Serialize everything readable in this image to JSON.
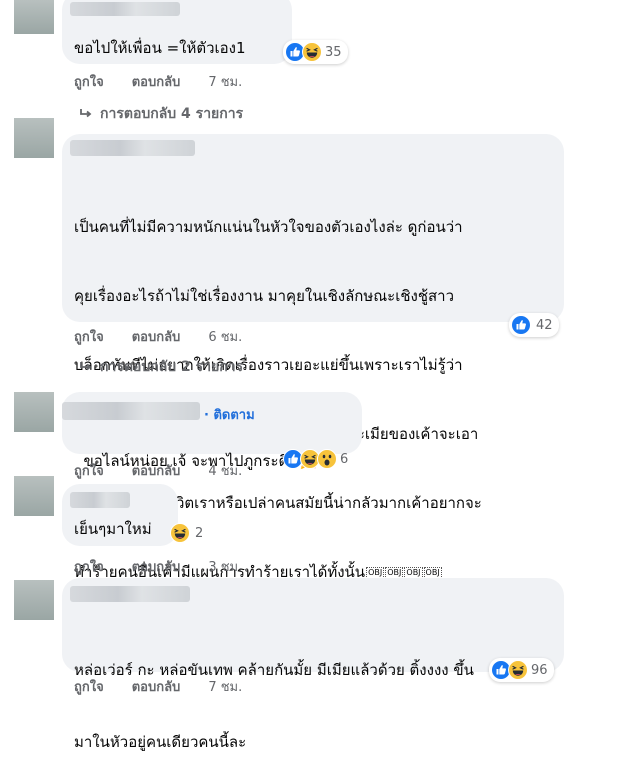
{
  "comments": [
    {
      "text": "ขอไปให้เพื่อน =ให้ตัวเอง1",
      "reaction_count": "35",
      "like": "ถูกใจ",
      "reply": "ตอบกลับ",
      "time": "7 ชม.",
      "replies_label": "การตอบกลับ 4 รายการ"
    },
    {
      "lines": [
        "เป็นคนที่ไม่มีความหนักแน่นในหัวใจของตัวเองไงล่ะ ดูก่อนว่า",
        "คุยเรื่องอะไรถ้าไม่ใช่เรื่องงาน มาคุยในเชิงลักษณะเชิงชู้สาว",
        "บล็อกทันทีไม่อยากให้เกิดเรื่องราวเยอะแย่ขึ้นเพราะเราไม่รู้ว่า",
        "ผู้ชายที่มีเมียแล้วเนี่ยเค้าคิดจะทำอะไรเราและเมียของเค้าจะเอา",
        "จุดนี้มาทำลายชีวิตเราหรือเปล่าคนสมัยนี้น่ากลัวมากเค้าอยากจะ",
        "ทำร้ายคนอื่นเค้ามีแผนการทำร้ายเราได้ทั้งนั้น"
      ],
      "obj_marks": [
        "OBJ",
        "OBJ",
        "OBJ",
        "OBJ"
      ],
      "reaction_count": "42",
      "like": "ถูกใจ",
      "reply": "ตอบกลับ",
      "time": "6 ชม.",
      "replies_label": "การตอบกลับ 2 รายการ"
    },
    {
      "follow": "· ติดตาม",
      "text": "ขอไลน์หน่อย เจ้ จะพาไปภูกระดึง",
      "confetti": "🎉",
      "reaction_count": "6",
      "like": "ถูกใจ",
      "reply": "ตอบกลับ",
      "time": "4 ชม."
    },
    {
      "text": "เย็นๆมาใหม่",
      "reaction_count": "2",
      "like": "ถูกใจ",
      "reply": "ตอบกลับ",
      "time": "3 ชม."
    },
    {
      "lines": [
        "หล่อเว่อร์ กะ หล่อขันเทพ คล้ายกันมั้ย มีเมียแล้วด้วย ติ้งงงง ขึ้น",
        "มาในหัวอยู่คนเดียวคนนี้ละ"
      ],
      "reaction_count": "96",
      "like": "ถูกใจ",
      "reply": "ตอบกลับ",
      "time": "7 ชม."
    }
  ],
  "colors": {
    "bubble": "#f0f2f5",
    "meta": "#65676b",
    "link": "#216fdb",
    "like_blue": "#1877f2",
    "haha_yellow": "#f7c33b"
  }
}
